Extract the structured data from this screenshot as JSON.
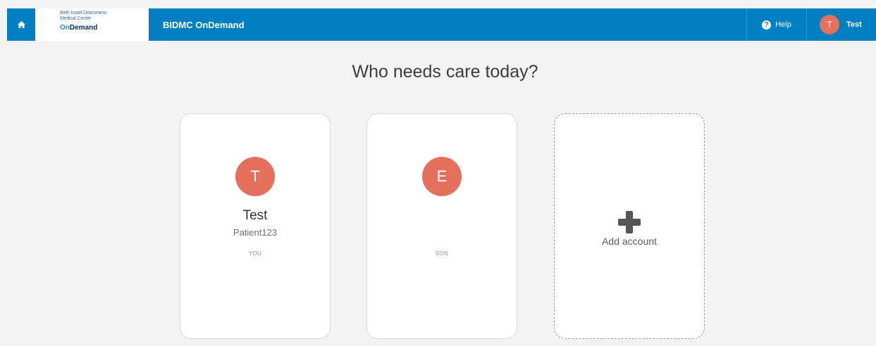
{
  "topbar": {
    "home_icon": "home-icon",
    "logo": {
      "line1": "Beth Israel Deaconess",
      "line2": "Medical Center",
      "brand_prefix": "On",
      "brand_suffix": "Demand"
    },
    "app_title": "BIDMC OnDemand",
    "help": {
      "icon": "help-icon",
      "glyph": "?",
      "label": "Help"
    },
    "user": {
      "initial": "T",
      "name": "Test"
    }
  },
  "heading": "Who needs care today?",
  "profiles": [
    {
      "initial": "T",
      "name": "Test",
      "subtitle": "Patient123",
      "relation": "YOU"
    },
    {
      "initial": "E",
      "name": "",
      "subtitle": "",
      "relation": "SON"
    }
  ],
  "add_account": {
    "icon": "plus-icon",
    "label": "Add account"
  },
  "colors": {
    "topbar": "#007fc3",
    "avatar": "#e5705c",
    "background": "#f3f3f3"
  }
}
